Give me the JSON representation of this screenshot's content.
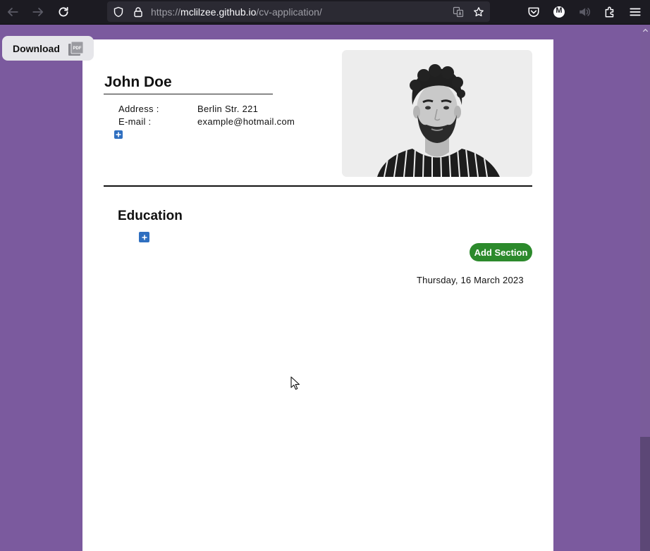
{
  "browser": {
    "url_prefix": "https://",
    "url_host": "mclilzee.github.io",
    "url_path": "/cv-application/",
    "profile_initial": "M"
  },
  "toolbar": {
    "download_label": "Download",
    "pdf_icon": "pdf-icon"
  },
  "cv": {
    "name": "John Doe",
    "info": [
      {
        "label": "Address :",
        "value": "Berlin Str. 221"
      },
      {
        "label": "E-mail :",
        "value": "example@hotmail.com"
      }
    ],
    "sections": [
      {
        "title": "Education"
      }
    ],
    "add_section_label": "Add Section",
    "date": "Thursday, 16 March 2023"
  },
  "colors": {
    "page_bg": "#7b5a9e",
    "add_section_bg": "#2c8a2c",
    "plus_button": "#2f6fc0"
  }
}
